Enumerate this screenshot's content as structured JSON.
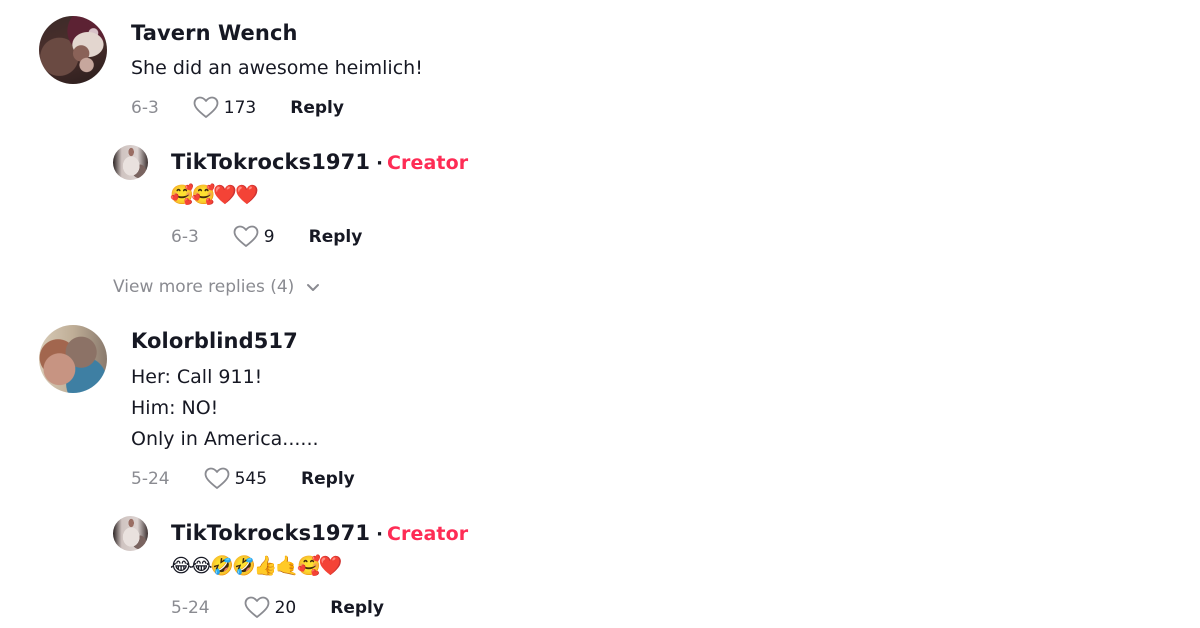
{
  "comments": [
    {
      "username": "Tavern Wench",
      "avatar": "avatar-tavern-wench",
      "lines": [
        "She did an awesome heimlich!"
      ],
      "date": "6-3",
      "likes": "173",
      "reply_label": "Reply",
      "replies": [
        {
          "username": "TikTokrocks1971",
          "separator": "·",
          "badge": "Creator",
          "avatar": "avatar-tiktokrocks1971",
          "text": "🥰🥰❤️❤️",
          "date": "6-3",
          "likes": "9",
          "reply_label": "Reply"
        }
      ],
      "view_more_label": "View more replies (4)"
    },
    {
      "username": "Kolorblind517",
      "avatar": "avatar-kolorblind517",
      "lines": [
        "Her: Call 911!",
        "Him: NO!",
        "Only in America......"
      ],
      "date": "5-24",
      "likes": "545",
      "reply_label": "Reply",
      "replies": [
        {
          "username": "TikTokrocks1971",
          "separator": "·",
          "badge": "Creator",
          "avatar": "avatar-tiktokrocks1971",
          "text": "😂😂🤣🤣👍🤙🥰❤️",
          "date": "5-24",
          "likes": "20",
          "reply_label": "Reply"
        }
      ]
    }
  ],
  "icons": {
    "like": "heart-outline-icon",
    "expand": "chevron-down-icon"
  },
  "colors": {
    "creator_badge": "#fe2c55",
    "text_primary": "#161823",
    "text_secondary": "#8a8b91"
  }
}
